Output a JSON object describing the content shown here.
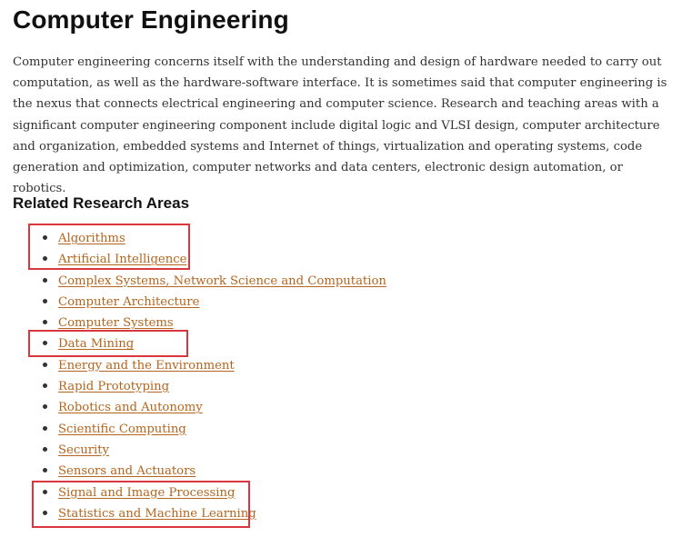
{
  "page": {
    "title": "Computer Engineering",
    "intro": "Computer engineering concerns itself with the understanding and design of hardware needed to carry out computation, as well as the hardware-software interface. It is sometimes said that computer engineering is the nexus that connects electrical engineering and computer science. Research and teaching areas with a significant computer engineering component include digital logic and VLSI design, computer architecture and organization, embedded systems and Internet of things, virtualization and operating systems, code generation and optimization, computer networks and data centers, electronic design automation, or robotics."
  },
  "related": {
    "heading": "Related Research Areas",
    "items": [
      {
        "label": "Algorithms",
        "highlighted": true
      },
      {
        "label": "Artificial Intelligence",
        "highlighted": true
      },
      {
        "label": "Complex Systems, Network Science and Computation",
        "highlighted": false
      },
      {
        "label": "Computer Architecture",
        "highlighted": false
      },
      {
        "label": "Computer Systems",
        "highlighted": false
      },
      {
        "label": "Data Mining",
        "highlighted": true
      },
      {
        "label": "Energy and the Environment",
        "highlighted": false
      },
      {
        "label": "Rapid Prototyping",
        "highlighted": false
      },
      {
        "label": "Robotics and Autonomy",
        "highlighted": false
      },
      {
        "label": "Scientific Computing",
        "highlighted": false
      },
      {
        "label": "Security",
        "highlighted": false
      },
      {
        "label": "Sensors and Actuators",
        "highlighted": false
      },
      {
        "label": "Signal and Image Processing",
        "highlighted": true
      },
      {
        "label": "Statistics and Machine Learning",
        "highlighted": true
      }
    ]
  },
  "colors": {
    "link": "#b5651d",
    "highlight_border": "#d9363e",
    "text": "#333333",
    "heading": "#111111"
  }
}
